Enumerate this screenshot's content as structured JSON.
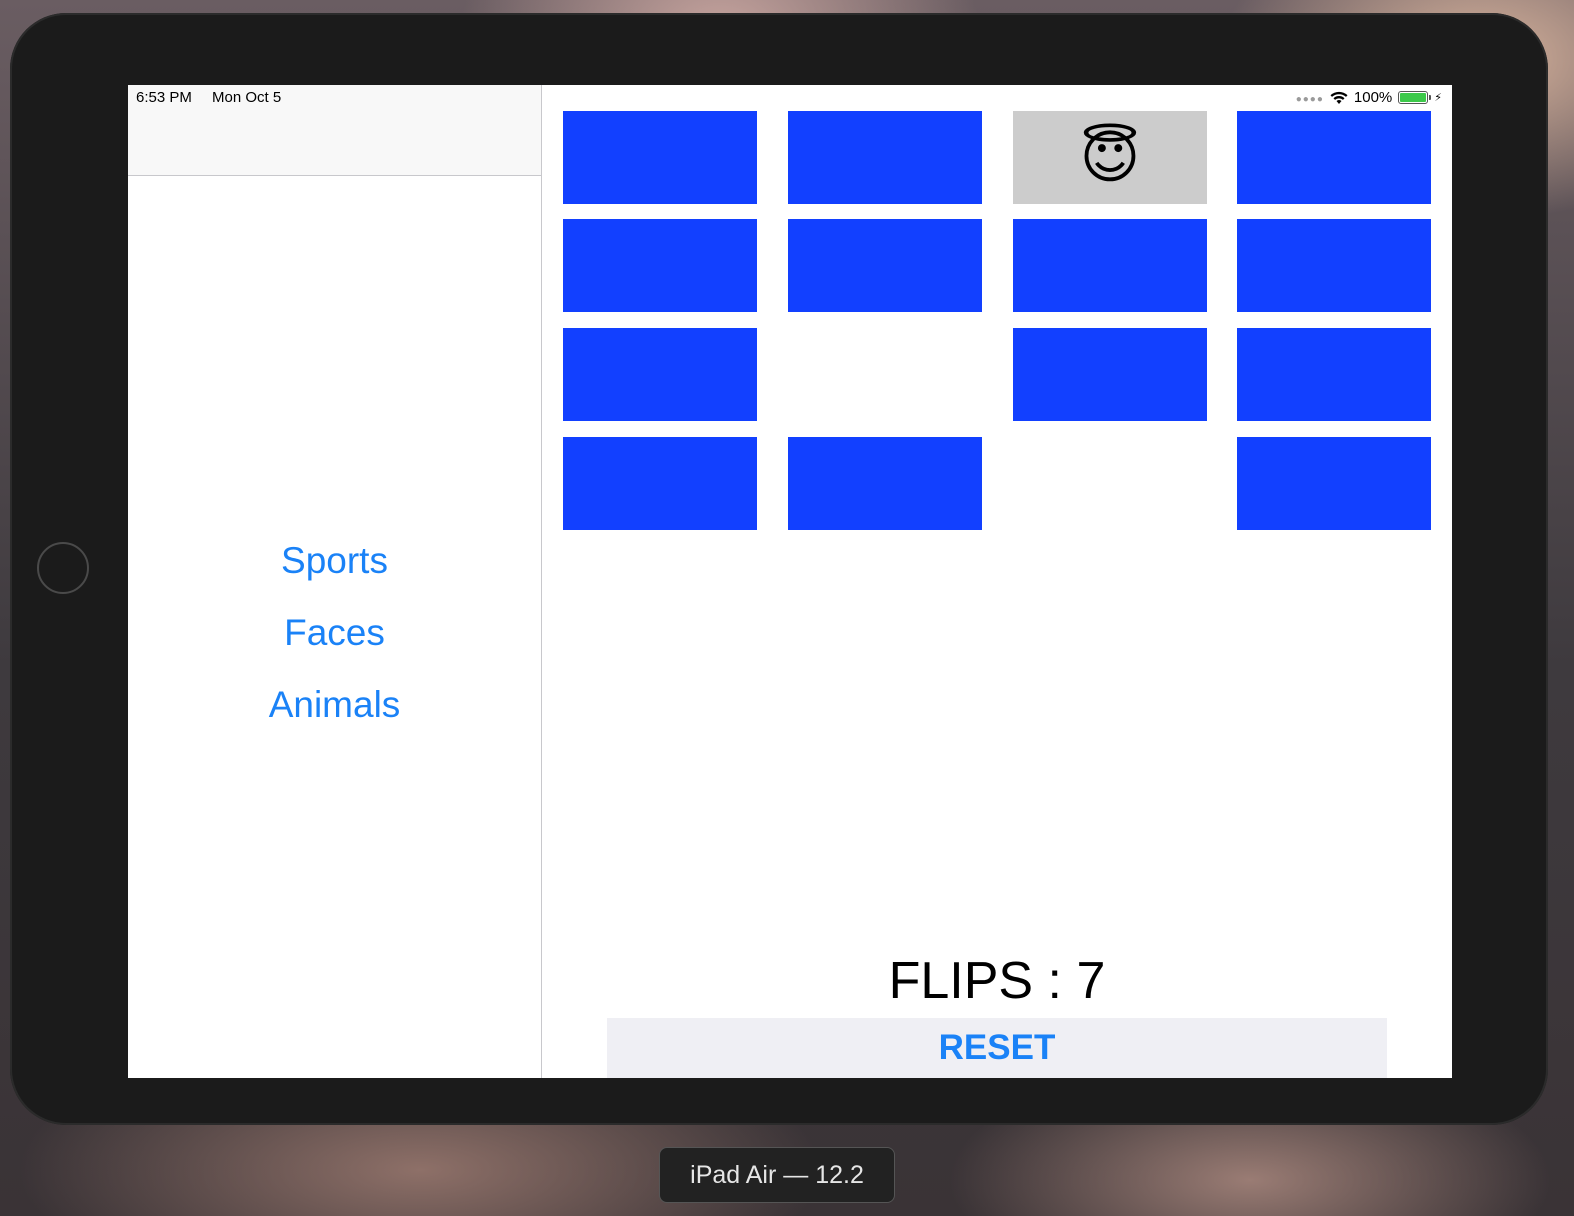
{
  "status_bar": {
    "time": "6:53 PM",
    "date": "Mon Oct 5",
    "battery": "100%",
    "battery_level": 1.0,
    "wifi_icon": "wifi-icon",
    "signal_icon": "cellular-dots-icon",
    "charging_icon": "bolt-icon"
  },
  "themes": {
    "items": [
      {
        "label": "Sports"
      },
      {
        "label": "Faces"
      },
      {
        "label": "Animals"
      }
    ]
  },
  "board": {
    "card_back_color": "#1240ff",
    "card_face_color": "#cccccc",
    "rows": [
      [
        {
          "state": "face-down",
          "emoji": ""
        },
        {
          "state": "face-down",
          "emoji": ""
        },
        {
          "state": "face-up",
          "emoji": "😇"
        },
        {
          "state": "face-down",
          "emoji": ""
        }
      ],
      [
        {
          "state": "face-down",
          "emoji": ""
        },
        {
          "state": "face-down",
          "emoji": ""
        },
        {
          "state": "face-down",
          "emoji": ""
        },
        {
          "state": "face-down",
          "emoji": ""
        }
      ],
      [
        {
          "state": "face-down",
          "emoji": ""
        },
        {
          "state": "matched",
          "emoji": ""
        },
        {
          "state": "face-down",
          "emoji": ""
        },
        {
          "state": "face-down",
          "emoji": ""
        }
      ],
      [
        {
          "state": "face-down",
          "emoji": ""
        },
        {
          "state": "face-down",
          "emoji": ""
        },
        {
          "state": "matched",
          "emoji": ""
        },
        {
          "state": "face-down",
          "emoji": ""
        }
      ]
    ]
  },
  "game": {
    "flips_label": "FLIPS : 7",
    "reset_label": "RESET"
  },
  "simulator": {
    "device_label": "iPad Air — 12.2"
  },
  "colors": {
    "accent": "#1a82f7",
    "battery_fill": "#3cc94a"
  }
}
